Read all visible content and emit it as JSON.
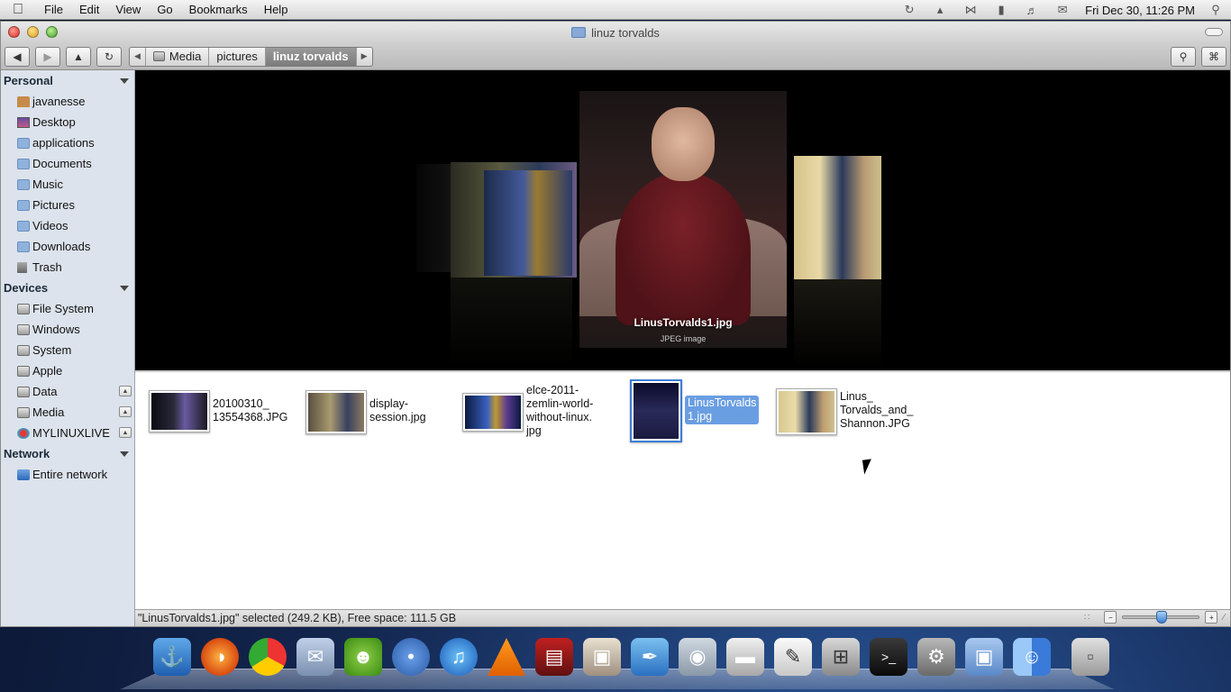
{
  "menubar": {
    "apple": "",
    "items": [
      "File",
      "Edit",
      "View",
      "Go",
      "Bookmarks",
      "Help"
    ],
    "clock": "Fri Dec 30, 11:26 PM"
  },
  "window": {
    "title": "linuz torvalds",
    "breadcrumbs": [
      "Media",
      "pictures",
      "linuz torvalds"
    ]
  },
  "sidebar": {
    "sections": [
      {
        "title": "Personal",
        "items": [
          "javanesse",
          "Desktop",
          "applications",
          "Documents",
          "Music",
          "Pictures",
          "Videos",
          "Downloads",
          "Trash"
        ]
      },
      {
        "title": "Devices",
        "items": [
          "File System",
          "Windows",
          "System",
          "Apple",
          "Data",
          "Media",
          "MYLINUXLIVE"
        ]
      },
      {
        "title": "Network",
        "items": [
          "Entire network"
        ]
      }
    ]
  },
  "coverflow": {
    "caption": "LinusTorvalds1.jpg",
    "subcaption": "JPEG image"
  },
  "files": [
    {
      "name": "20100310_\n13554368.JPG"
    },
    {
      "name": "display-\nsession.jpg"
    },
    {
      "name": "elce-2011-\nzemlin-world-\nwithout-linux.\njpg"
    },
    {
      "name": "LinusTorvalds\n1.jpg",
      "selected": true
    },
    {
      "name": "Linus_\nTorvalds_and_\nShannon.JPG"
    }
  ],
  "status": {
    "text": "\"LinusTorvalds1.jpg\" selected (249.2 KB), Free space: 111.5 GB",
    "zoom_level": 0.5
  },
  "dock": {
    "icons": [
      "anchor-icon",
      "firefox-icon",
      "chrome-icon",
      "mail-stamp-icon",
      "pidgin-icon",
      "footprint-icon",
      "itunes-icon",
      "vlc-icon",
      "film-icon",
      "photos-icon",
      "quill-icon",
      "camera-icon",
      "scanner-icon",
      "text-edit-icon",
      "calculator-icon",
      "terminal-icon",
      "settings-icon",
      "folder-icon",
      "finder-icon",
      "trash-icon"
    ]
  }
}
